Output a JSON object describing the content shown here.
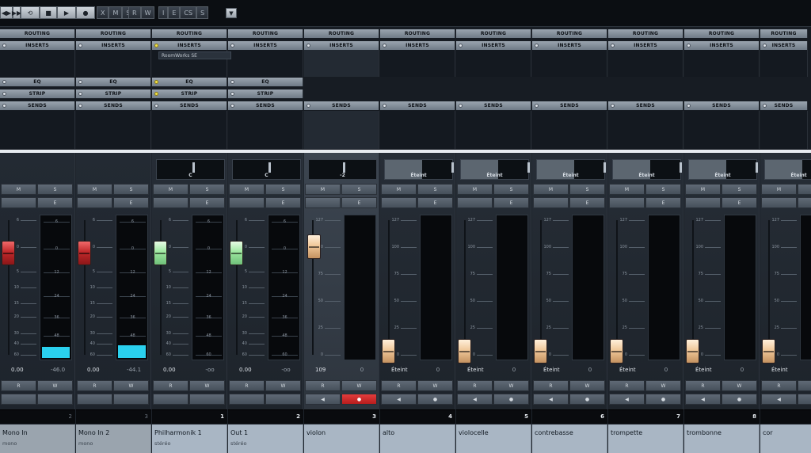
{
  "toolbar": {
    "transport": [
      "◀▶",
      "▶▶",
      "⟲",
      "■",
      "▶",
      "●"
    ],
    "modes_a": [
      "X",
      "M",
      "S"
    ],
    "modes_b": [
      "R",
      "W"
    ],
    "modes_c": [
      "I",
      "E",
      "CS",
      "S"
    ],
    "dropdown_icon": "▼"
  },
  "racks": {
    "routing_label": "ROUTING",
    "inserts_label": "INSERTS",
    "eq_label": "EQ",
    "strip_label": "STRIP",
    "sends_label": "SENDS",
    "plugin": "RoomWorks SE"
  },
  "buttons": {
    "m": "M",
    "s": "S",
    "e": "E",
    "r": "R",
    "w": "W",
    "play_left": "◀",
    "rec_dot": "●"
  },
  "colors": {
    "meter": "#2ad0ee",
    "rec_active": "#e33c3c",
    "name_bg": "#a9b6c4"
  },
  "channels": [
    {
      "name": "Mono In",
      "type": "mono",
      "number": "2",
      "pan": "",
      "fader_val": "0.00",
      "meter_val": "-46.0",
      "fader_color": "red",
      "kind": "input",
      "meter_level": 0.08
    },
    {
      "name": "Mono In 2",
      "type": "mono",
      "number": "3",
      "pan": "",
      "fader_val": "0.00",
      "meter_val": "-44.1",
      "fader_color": "red",
      "kind": "input",
      "meter_level": 0.09
    },
    {
      "name": "Philharmonik 1",
      "type": "stéréo",
      "number": "1",
      "pan": "C",
      "fader_val": "0.00",
      "meter_val": "-oo",
      "fader_color": "green",
      "kind": "audio",
      "meter_level": 0
    },
    {
      "name": "Out 1",
      "type": "stéréo",
      "number": "2",
      "pan": "C",
      "fader_val": "0.00",
      "meter_val": "-oo",
      "fader_color": "green",
      "kind": "audio",
      "meter_level": 0
    },
    {
      "name": "violon",
      "type": "",
      "number": "3",
      "pan": "-2",
      "fader_val": "109",
      "meter_val": "0",
      "fader_color": "tan",
      "kind": "midi",
      "meter_level": 0
    },
    {
      "name": "alto",
      "type": "",
      "number": "4",
      "pan": "Éteint",
      "fader_val": "Éteint",
      "meter_val": "0",
      "fader_color": "tan",
      "kind": "midi",
      "meter_level": 0
    },
    {
      "name": "violocelle",
      "type": "",
      "number": "5",
      "pan": "Éteint",
      "fader_val": "Éteint",
      "meter_val": "0",
      "fader_color": "tan",
      "kind": "midi",
      "meter_level": 0
    },
    {
      "name": "contrebasse",
      "type": "",
      "number": "6",
      "pan": "Éteint",
      "fader_val": "Éteint",
      "meter_val": "0",
      "fader_color": "tan",
      "kind": "midi",
      "meter_level": 0
    },
    {
      "name": "trompette",
      "type": "",
      "number": "7",
      "pan": "Éteint",
      "fader_val": "Éteint",
      "meter_val": "0",
      "fader_color": "tan",
      "kind": "midi",
      "meter_level": 0
    },
    {
      "name": "trombonne",
      "type": "",
      "number": "8",
      "pan": "Éteint",
      "fader_val": "Éteint",
      "meter_val": "0",
      "fader_color": "tan",
      "kind": "midi",
      "meter_level": 0
    },
    {
      "name": "cor",
      "type": "",
      "number": "",
      "pan": "Éteint",
      "fader_val": "Éteint",
      "meter_val": "",
      "fader_color": "tan",
      "kind": "midi",
      "meter_level": 0
    }
  ],
  "scales": {
    "audio": [
      "6",
      "0",
      "5",
      "10",
      "15",
      "20",
      "30",
      "40",
      "60"
    ],
    "audio_meter": [
      "6",
      "0",
      "12",
      "24",
      "36",
      "48",
      "60"
    ],
    "midi": [
      "127",
      "100",
      "75",
      "50",
      "25",
      "0"
    ]
  }
}
